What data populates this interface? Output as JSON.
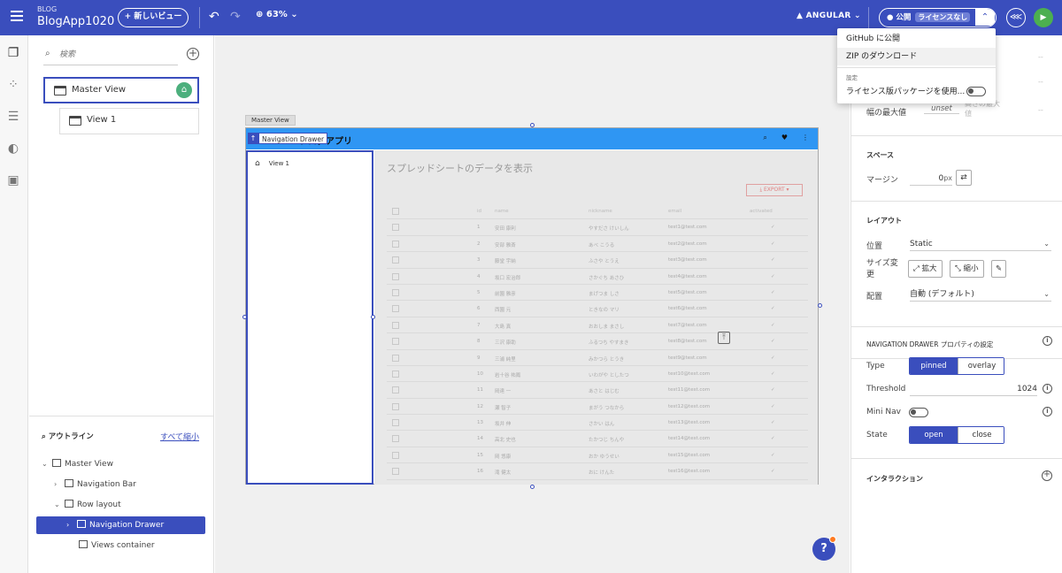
{
  "header": {
    "app_sub": "BLOG",
    "app_title": "BlogApp1020",
    "new_view": "+ 新しいビュー",
    "zoom": "63%",
    "framework": "ANGULAR",
    "publish": "公開",
    "license_badge": "ライセンスなし"
  },
  "publish_menu": {
    "items": [
      "GitHub に公開",
      "ZIP のダウンロード"
    ],
    "settings_heading": "設定",
    "license_option": "ライセンス版パッケージを使用..."
  },
  "views": {
    "search_placeholder": "検索",
    "master": "Master View",
    "child": "View 1"
  },
  "outline": {
    "title": "アウトライン",
    "collapse_all": "すべて縮小",
    "items": [
      "Master View",
      "Navigation Bar",
      "Row layout",
      "Navigation Drawer",
      "Views container"
    ]
  },
  "canvas": {
    "frame_tab": "Master View",
    "nav_tag": "Navigation Drawer",
    "app_bar_title": "ブログアプリ",
    "drawer_item": "View 1",
    "main_title": "スプレッドシートのデータを表示",
    "export": "EXPORT",
    "grid_headers": [
      "id",
      "name",
      "nickname",
      "email",
      "activated"
    ],
    "grid_rows": [
      [
        "1",
        "安田 康利",
        "やすださ けいしん",
        "test1@test.com"
      ],
      [
        "2",
        "安部 雅斎",
        "あべ こうる",
        "test2@test.com"
      ],
      [
        "3",
        "藤堂 宇納",
        "ふさや とうえ",
        "test3@test.com"
      ],
      [
        "4",
        "坂口 宏治郎",
        "さかぐち あさひ",
        "test4@test.com"
      ],
      [
        "5",
        "前園 雅彦",
        "まげつま しさ",
        "test5@test.com"
      ],
      [
        "6",
        "西園 元",
        "ときなの マリ",
        "test6@test.com"
      ],
      [
        "7",
        "大島 真",
        "おおしま まさし",
        "test7@test.com"
      ],
      [
        "8",
        "三沢 康助",
        "ふるつち やすまき",
        "test8@test.com"
      ],
      [
        "9",
        "三浦 純里",
        "みかつら とうき",
        "test9@test.com"
      ],
      [
        "10",
        "岩十谷 祐鳳",
        "いわがや としたつ",
        "test10@test.com"
      ],
      [
        "11",
        "岡達 一",
        "あさと はじむ",
        "test11@test.com"
      ],
      [
        "12",
        "瀬 智子",
        "まがう つなから",
        "test12@test.com"
      ],
      [
        "13",
        "坂井 伸",
        "さかい はん",
        "test13@test.com"
      ],
      [
        "14",
        "高北 史也",
        "たかつじ ちんや",
        "test14@test.com"
      ],
      [
        "15",
        "岡 悠康",
        "おか ゆうせい",
        "test15@test.com"
      ],
      [
        "16",
        "滝 健太",
        "おに けんた",
        "test16@test.com"
      ]
    ]
  },
  "props": {
    "max_width_label": "幅の最大値",
    "max_width_value": "unset",
    "ghost_min": "小",
    "ghost_max_h": "高さの最大値",
    "ghost_dash": "--",
    "space_title": "スペース",
    "margin_label": "マージン",
    "margin_value": "0",
    "margin_unit": "px",
    "layout_title": "レイアウト",
    "position_label": "位置",
    "position_value": "Static",
    "resize_label": "サイズ変更",
    "expand": "拡大",
    "shrink": "縮小",
    "align_label": "配置",
    "align_value": "自動 (デフォルト)",
    "nav_title": "NAVIGATION DRAWER プロパティの設定",
    "type_label": "Type",
    "type_pinned": "pinned",
    "type_overlay": "overlay",
    "threshold_label": "Threshold",
    "threshold_value": "1024",
    "mininav_label": "Mini Nav",
    "state_label": "State",
    "state_open": "open",
    "state_close": "close",
    "interaction_title": "インタラクション"
  },
  "icons": {
    "search": "search-icon",
    "help": "?"
  }
}
